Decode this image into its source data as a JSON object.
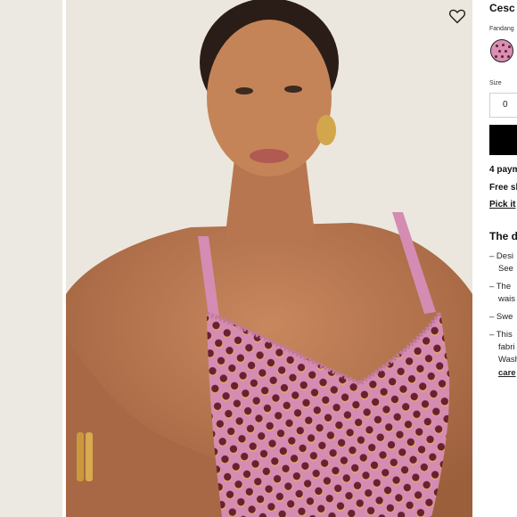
{
  "gallery": {
    "wishlist_icon": "heart-icon",
    "top_color": "#d48cb3",
    "dot_color": "#6a1f33",
    "dot_halo_color": "#e0a86a"
  },
  "product": {
    "title": "Cesc",
    "color_label": "Fandang",
    "size_label": "Size",
    "selected_size": "0"
  },
  "info": {
    "payment": "4 paym",
    "shipping": "Free sh",
    "pickup": "Pick it"
  },
  "details": {
    "heading": "The d",
    "bullets": [
      {
        "line1": "– Desi",
        "line2": "See"
      },
      {
        "line1": "– The",
        "line2": "wais"
      },
      {
        "line1": "– Swe"
      },
      {
        "line1": "– This",
        "line2": "fabri",
        "line3": "Wash",
        "link": "care"
      }
    ]
  }
}
